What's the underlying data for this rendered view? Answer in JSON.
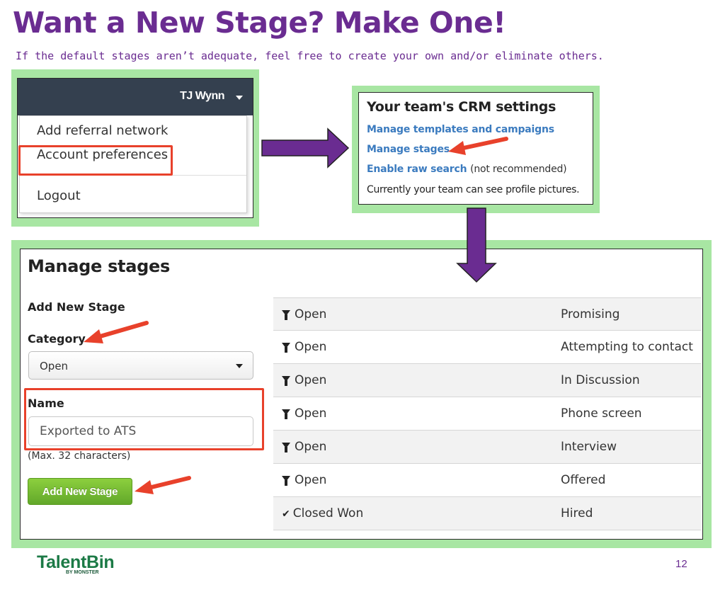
{
  "slide": {
    "title": "Want a New Stage? Make One!",
    "subtitle": "If the default stages aren’t adequate, feel free to create your own and/or eliminate others.",
    "page_number": "12",
    "colors": {
      "title": "#6a2c91",
      "frame": "#a8e6a3",
      "callout": "#e8412b",
      "arrow": "#6a2c91"
    }
  },
  "dropdown_panel": {
    "user_name": "TJ Wynn",
    "menu_items": [
      "Add referral network",
      "Account preferences",
      "Logout"
    ],
    "highlighted_item": "Account preferences"
  },
  "crm_panel": {
    "title": "Your team's CRM settings",
    "links": {
      "templates": "Manage templates and campaigns",
      "stages": "Manage stages",
      "raw_search": "Enable raw search"
    },
    "raw_search_note": "(not recommended)",
    "status_text": "Currently your team can see profile pictures."
  },
  "stages_panel": {
    "title": "Manage stages",
    "form": {
      "heading": "Add New Stage",
      "category_label": "Category",
      "category_value": "Open",
      "name_label": "Name",
      "name_value": "Exported to ATS",
      "hint": "(Max. 32 characters)",
      "submit_label": "Add New Stage"
    },
    "stages": [
      {
        "icon": "funnel-icon",
        "category": "Open",
        "name": "Promising"
      },
      {
        "icon": "funnel-icon",
        "category": "Open",
        "name": "Attempting to contact"
      },
      {
        "icon": "funnel-icon",
        "category": "Open",
        "name": "In Discussion"
      },
      {
        "icon": "funnel-icon",
        "category": "Open",
        "name": "Phone screen"
      },
      {
        "icon": "funnel-icon",
        "category": "Open",
        "name": "Interview"
      },
      {
        "icon": "funnel-icon",
        "category": "Open",
        "name": "Offered"
      },
      {
        "icon": "check-icon",
        "category": "Closed Won",
        "name": "Hired"
      }
    ]
  },
  "footer": {
    "logo_text": "TalentBin",
    "logo_subtext": "BY MONSTER"
  }
}
